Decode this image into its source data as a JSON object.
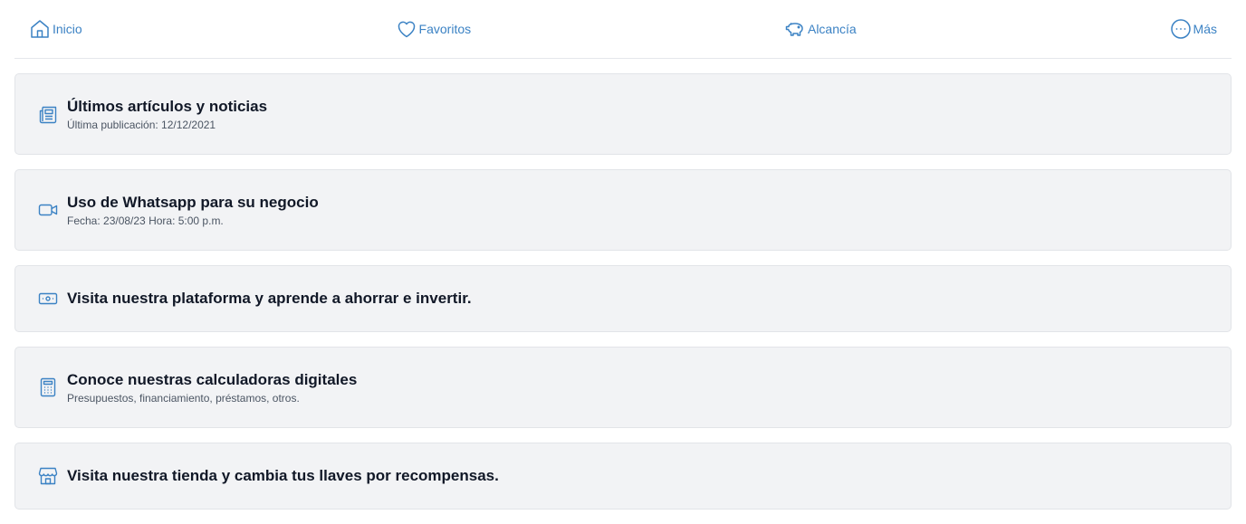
{
  "nav": {
    "items": [
      {
        "label": "Inicio",
        "icon": "home-icon"
      },
      {
        "label": "Favoritos",
        "icon": "heart-icon"
      },
      {
        "label": "Alcancía",
        "icon": "piggy-bank-icon"
      },
      {
        "label": "Más",
        "icon": "more-icon"
      }
    ]
  },
  "cards": [
    {
      "title": "Últimos artículos y noticias",
      "subtitle": "Última publicación: 12/12/2021",
      "icon": "newspaper-icon"
    },
    {
      "title": "Uso de Whatsapp para su negocio",
      "subtitle": "Fecha: 23/08/23 Hora: 5:00 p.m.",
      "icon": "video-camera-icon"
    },
    {
      "title": "Visita nuestra plataforma y aprende a ahorrar e invertir.",
      "icon": "banknote-icon"
    },
    {
      "title": "Conoce nuestras calculadoras digitales",
      "subtitle": "Presupuestos, financiamiento, préstamos, otros.",
      "icon": "calculator-icon"
    },
    {
      "title": "Visita nuestra tienda y cambia tus llaves por recompensas.",
      "icon": "store-icon"
    }
  ],
  "colors": {
    "accent": "#3b82c4",
    "card_bg": "#f2f3f5",
    "border": "#e5e7eb"
  }
}
